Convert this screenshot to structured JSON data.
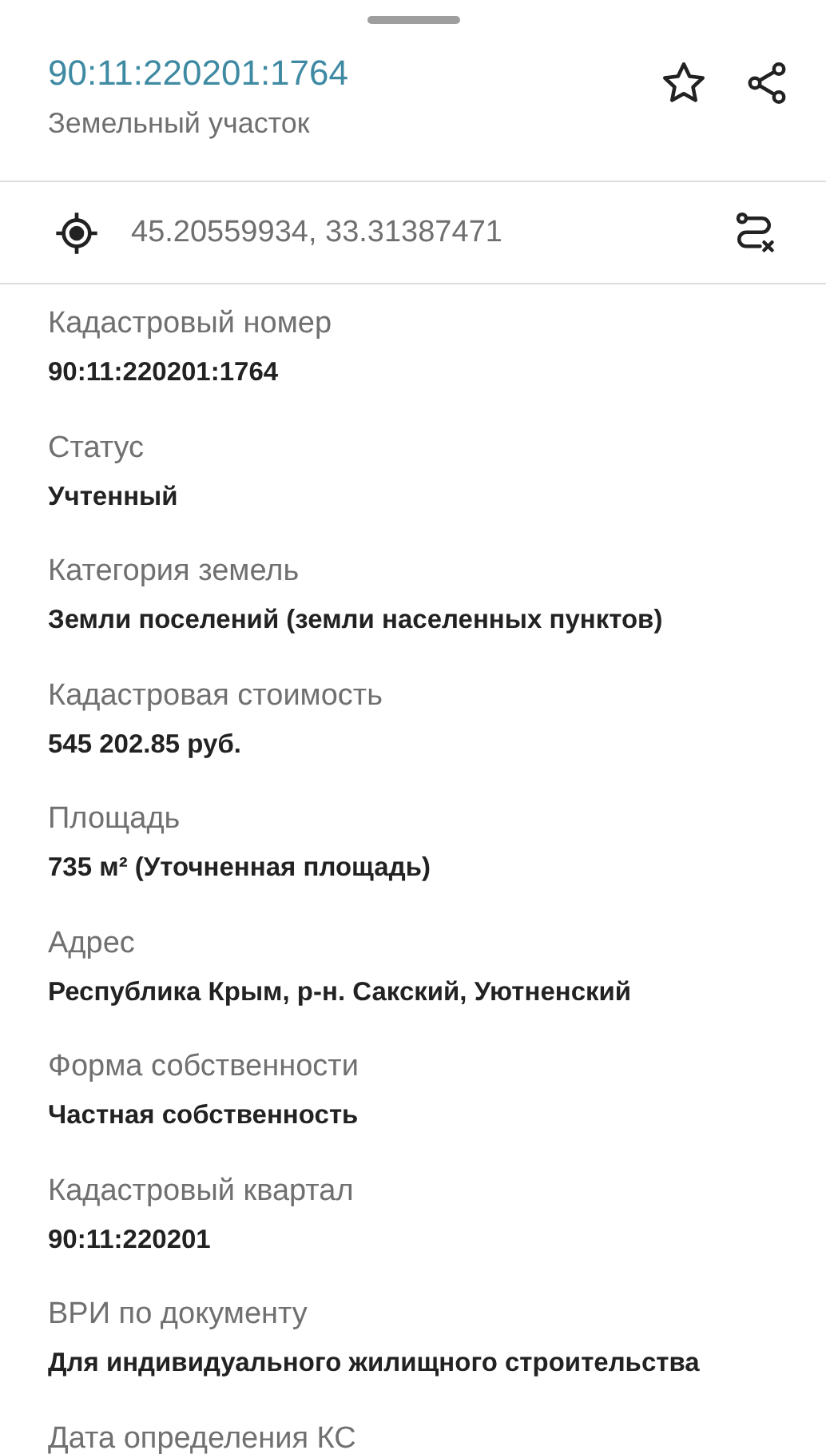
{
  "header": {
    "title": "90:11:220201:1764",
    "subtitle": "Земельный участок"
  },
  "coordinates": "45.20559934, 33.31387471",
  "fields": [
    {
      "label": "Кадастровый номер",
      "value": "90:11:220201:1764"
    },
    {
      "label": "Статус",
      "value": "Учтенный"
    },
    {
      "label": "Категория земель",
      "value": "Земли поселений (земли населенных пунктов)"
    },
    {
      "label": "Кадастровая стоимость",
      "value": "545 202.85 руб."
    },
    {
      "label": "Площадь",
      "value": "735 м² (Уточненная площадь)"
    },
    {
      "label": "Адрес",
      "value": "Республика Крым, р-н. Сакский, Уютненский"
    },
    {
      "label": "Форма собственности",
      "value": "Частная собственность"
    },
    {
      "label": "Кадастровый квартал",
      "value": "90:11:220201"
    },
    {
      "label": "ВРИ по документу",
      "value": "Для индивидуального жилищного строительства"
    },
    {
      "label": "Дата определения КС"
    }
  ]
}
